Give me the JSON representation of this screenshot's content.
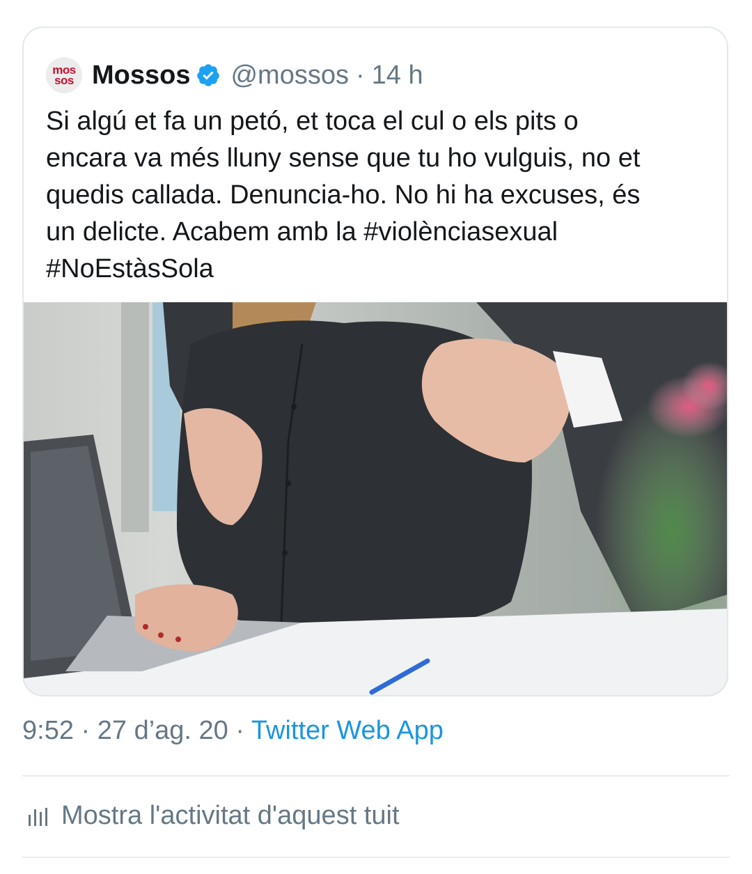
{
  "quoted_tweet": {
    "avatar_text_top": "mos",
    "avatar_text_bottom": "sos",
    "display_name": "Mossos",
    "handle": "@mossos",
    "separator": "·",
    "time_ago": "14 h",
    "text": "Si algú et fa un petó, et toca el cul o els pits o\nencara va més lluny sense que tu ho vulguis, no et\nquedis callada. Denuncia-ho. No hi ha excuses, és\nun delicte. Acabem amb la #violènciasexual\n#NoEstàsSola",
    "verified_icon": "verified-badge-icon",
    "media": "photo"
  },
  "meta": {
    "time": "9:52",
    "sep1": " · ",
    "date": "27 d’ag. 20",
    "sep2": " · ",
    "source": "Twitter Web App"
  },
  "activity": {
    "icon": "analytics-icon",
    "label": "Mostra l'activitat d'aquest tuit"
  },
  "colors": {
    "text": "#14171a",
    "secondary": "#657786",
    "link": "#1b95e0",
    "verified": "#1da1f2",
    "border": "#e1e8ed",
    "brand_red": "#c8102e"
  }
}
